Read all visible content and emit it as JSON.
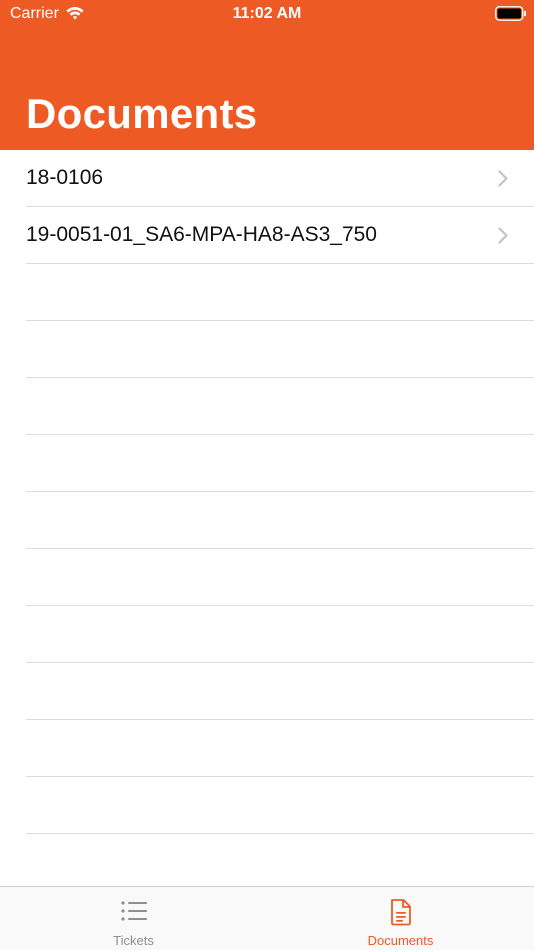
{
  "status_bar": {
    "carrier": "Carrier",
    "time": "11:02 AM",
    "wifi_icon": "wifi-icon",
    "battery_icon": "battery-icon"
  },
  "header": {
    "title": "Documents",
    "background_color": "#ee5a24"
  },
  "documents": {
    "items": [
      {
        "label": "18-0106"
      },
      {
        "label": "19-0051-01_SA6-MPA-HA8-AS3_750"
      }
    ],
    "empty_rows": 11
  },
  "tab_bar": {
    "tabs": [
      {
        "label": "Tickets",
        "icon": "list-icon",
        "selected": false
      },
      {
        "label": "Documents",
        "icon": "document-icon",
        "selected": true
      }
    ],
    "active_color": "#ee5a24",
    "inactive_color": "#8e8e93"
  }
}
